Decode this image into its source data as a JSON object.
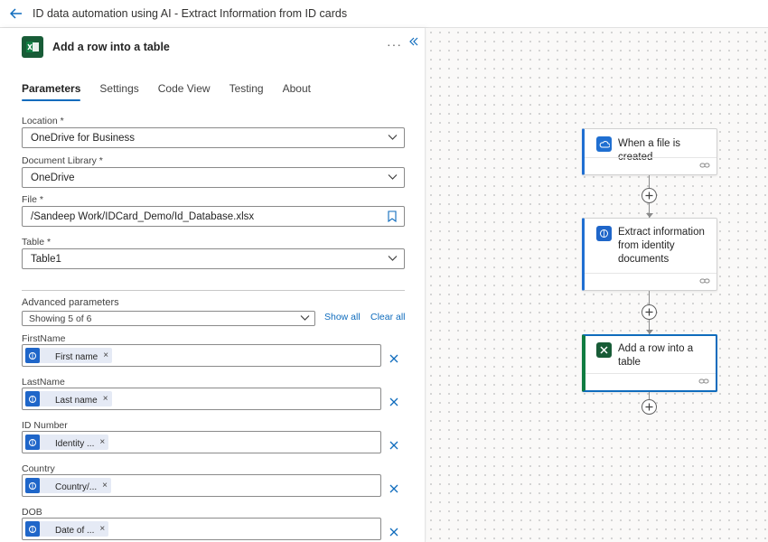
{
  "topbar": {
    "title": "ID data automation using AI - Extract Information from ID cards",
    "back_icon": "arrow-left-icon"
  },
  "panel": {
    "title": "Add a row into a table",
    "more_label": "···",
    "tabs": [
      {
        "label": "Parameters",
        "active": true
      },
      {
        "label": "Settings",
        "active": false
      },
      {
        "label": "Code View",
        "active": false
      },
      {
        "label": "Testing",
        "active": false
      },
      {
        "label": "About",
        "active": false
      }
    ],
    "fields": {
      "location": {
        "label": "Location *",
        "value": "OneDrive for Business"
      },
      "library": {
        "label": "Document Library *",
        "value": "OneDrive"
      },
      "file": {
        "label": "File *",
        "value": "/Sandeep Work/IDCard_Demo/Id_Database.xlsx"
      },
      "table": {
        "label": "Table *",
        "value": "Table1"
      }
    },
    "advanced": {
      "label": "Advanced parameters",
      "showing": "Showing 5 of 6",
      "show_all": "Show all",
      "clear_all": "Clear all"
    },
    "params": [
      {
        "label": "FirstName",
        "token": "First name"
      },
      {
        "label": "LastName",
        "token": "Last name"
      },
      {
        "label": "ID Number",
        "token": "Identity ..."
      },
      {
        "label": "Country",
        "token": "Country/..."
      },
      {
        "label": "DOB",
        "token": "Date of ..."
      }
    ]
  },
  "canvas": {
    "cards": [
      {
        "title": "When a file is created",
        "icon": "onedrive-cloud-icon"
      },
      {
        "title": "Extract information from identity documents",
        "icon": "ai-builder-icon"
      },
      {
        "title": "Add a row into a table",
        "icon": "excel-icon"
      }
    ]
  },
  "colors": {
    "accent": "#0f6cbd",
    "excel": "#185c37",
    "onedrive": "#1f6fd1"
  }
}
